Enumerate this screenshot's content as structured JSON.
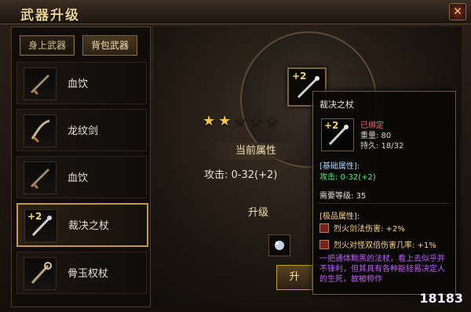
{
  "window": {
    "title": "武器升级",
    "close_symbol": "✕"
  },
  "tabs": [
    {
      "label": "身上武器"
    },
    {
      "label": "背包武器"
    }
  ],
  "weapon_list": [
    {
      "label": "血饮",
      "plus": ""
    },
    {
      "label": "龙纹剑",
      "plus": ""
    },
    {
      "label": "血饮",
      "plus": ""
    },
    {
      "label": "裁决之杖",
      "plus": "+2"
    },
    {
      "label": "骨玉权杖",
      "plus": ""
    }
  ],
  "main": {
    "slot_plus": "+2",
    "stars": {
      "filled": 2,
      "total": 5
    },
    "current_attr_title": "当前属性",
    "attack_text": "攻击: 0-32(+2)",
    "upgrade_section_text": "升级",
    "upgrade_button_label": "升"
  },
  "tooltip": {
    "name": "裁决之杖",
    "icon_plus": "+2",
    "bound": "已绑定",
    "weight": "重量: 80",
    "durability": "持久: 18/32",
    "base_title": "[基础属性]:",
    "base_value": "攻击: 0-32(+2)",
    "required_level": "需要等级: 35",
    "extra_title": "[极品属性]:",
    "extra_rows": [
      {
        "text": "烈火剑法伤害: +2%"
      },
      {
        "text": "烈火对怪双倍伤害几率: +1%"
      }
    ],
    "description": "一把通体黝黑的法杖，看上去似乎并不锋利，但其具有各种能轻易决定人的生死，故被称作"
  },
  "watermark": "18183"
}
